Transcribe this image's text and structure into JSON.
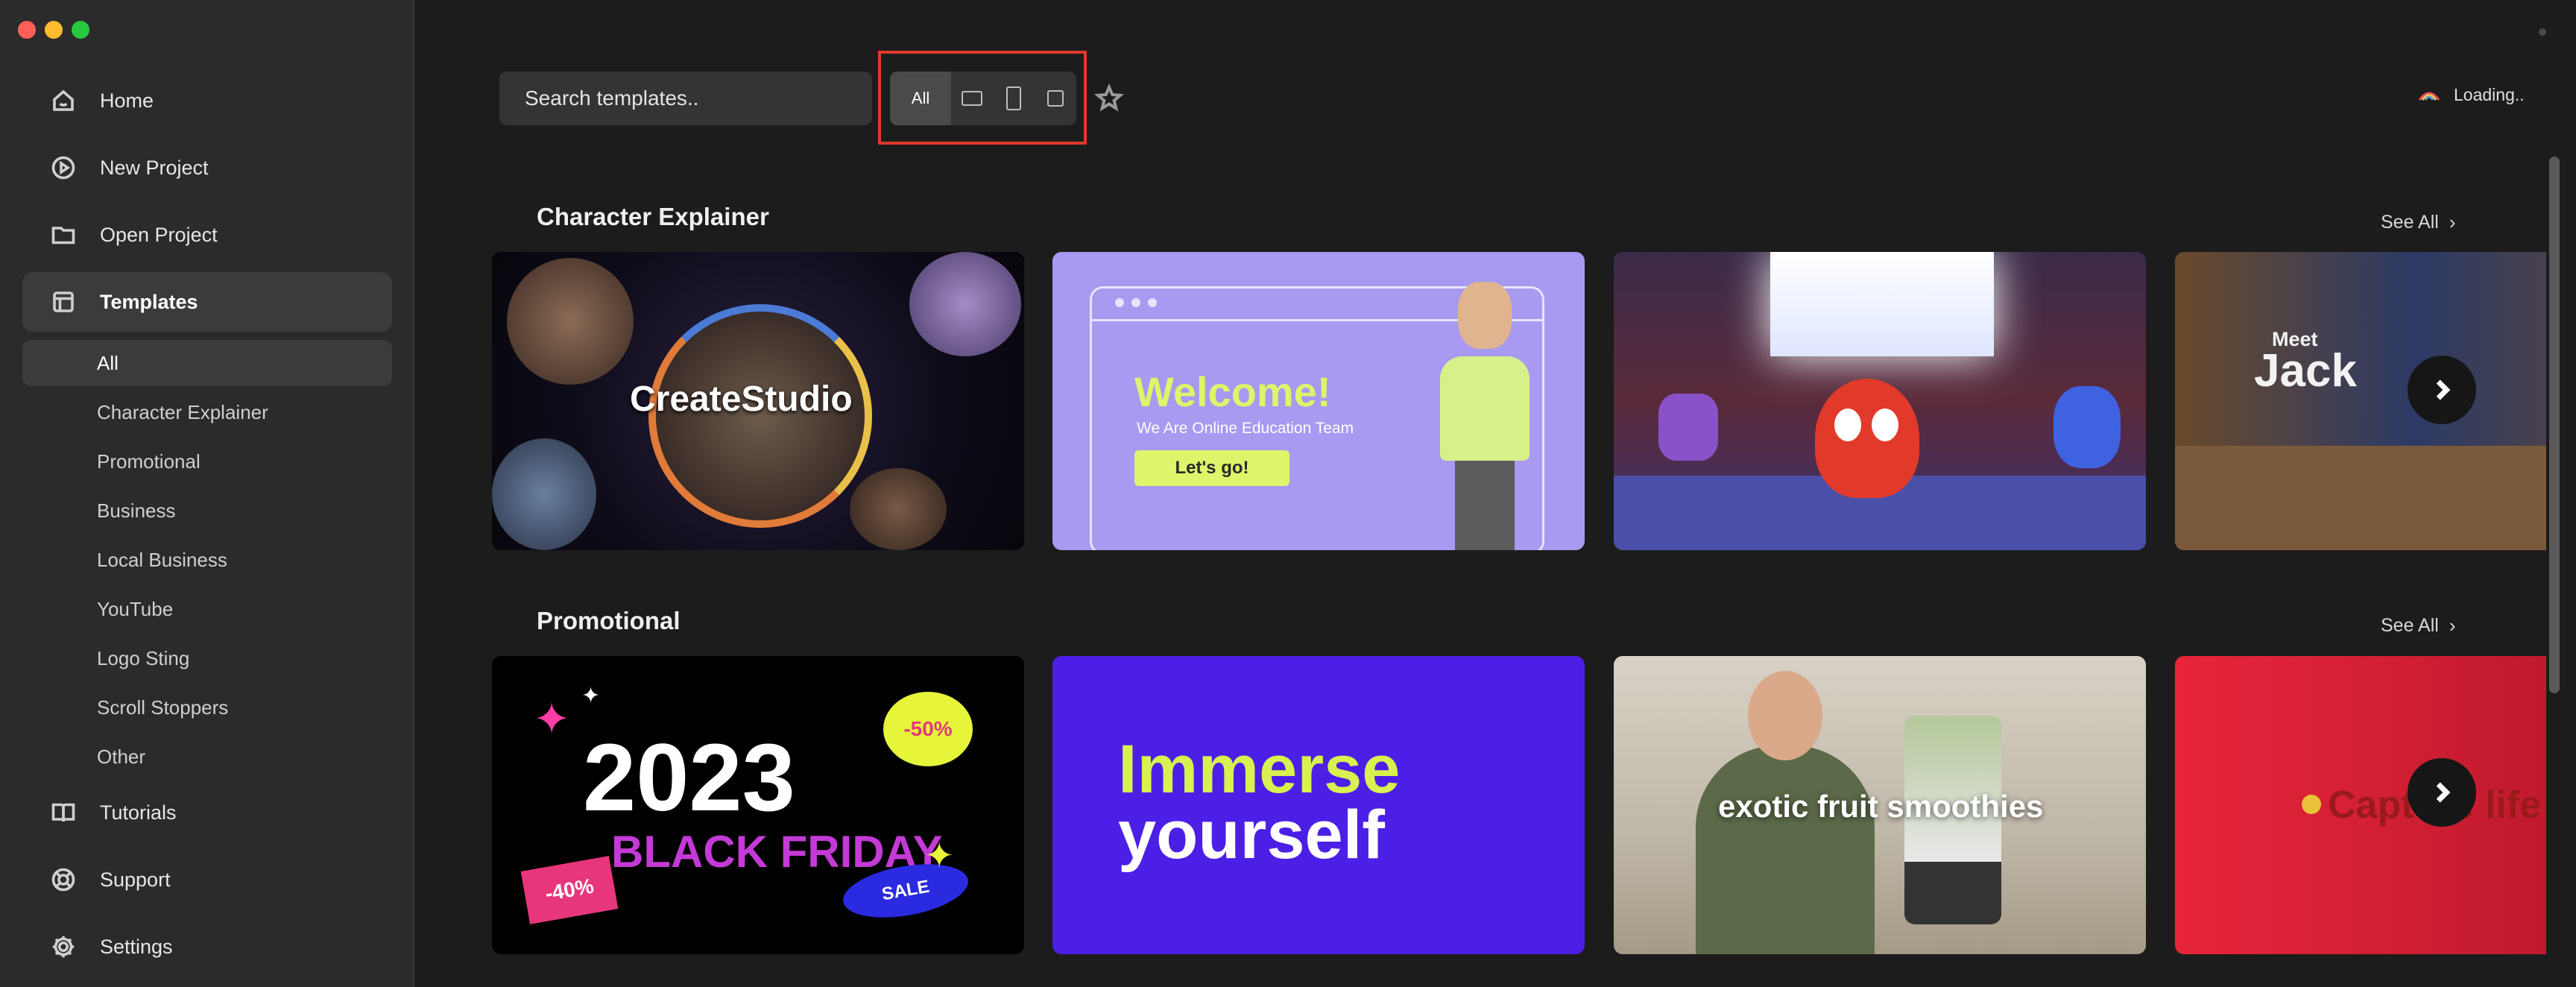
{
  "sidebar": {
    "nav": [
      {
        "label": "Home",
        "icon": "home-icon"
      },
      {
        "label": "New Project",
        "icon": "play-circle-icon"
      },
      {
        "label": "Open Project",
        "icon": "folder-icon"
      },
      {
        "label": "Templates",
        "icon": "layout-icon"
      }
    ],
    "sub": [
      "All",
      "Character Explainer",
      "Promotional",
      "Business",
      "Local Business",
      "YouTube",
      "Logo Sting",
      "Scroll Stoppers",
      "Other"
    ],
    "bottom": [
      {
        "label": "Tutorials",
        "icon": "book-icon"
      },
      {
        "label": "Support",
        "icon": "lifebuoy-icon"
      },
      {
        "label": "Settings",
        "icon": "gear-icon"
      }
    ]
  },
  "search": {
    "placeholder": "Search templates.."
  },
  "filter": {
    "all_label": "All"
  },
  "status": {
    "text": "Loading.."
  },
  "sections": [
    {
      "title": "Character Explainer",
      "see_all": "See All",
      "cards": [
        {
          "text": "CreateStudio"
        },
        {
          "text": "Welcome!",
          "subtitle": "We Are Online Education Team",
          "button": "Let's go!"
        },
        {
          "text": ""
        },
        {
          "text": "Meet",
          "text2": "Jack"
        }
      ]
    },
    {
      "title": "Promotional",
      "see_all": "See All",
      "cards": [
        {
          "text": "2023",
          "text2": "BLACK FRIDAY",
          "badge1": "-50%",
          "badge2": "-40%",
          "badge3": "SALE"
        },
        {
          "text": "Immerse",
          "text2": "yourself"
        },
        {
          "text": "exotic fruit smoothies"
        },
        {
          "text": "Capture life"
        }
      ]
    }
  ],
  "colors": {
    "accent_outline": "#e0392b",
    "sidebar_bg": "#2b2b2b",
    "main_bg": "#1c1c1c"
  }
}
